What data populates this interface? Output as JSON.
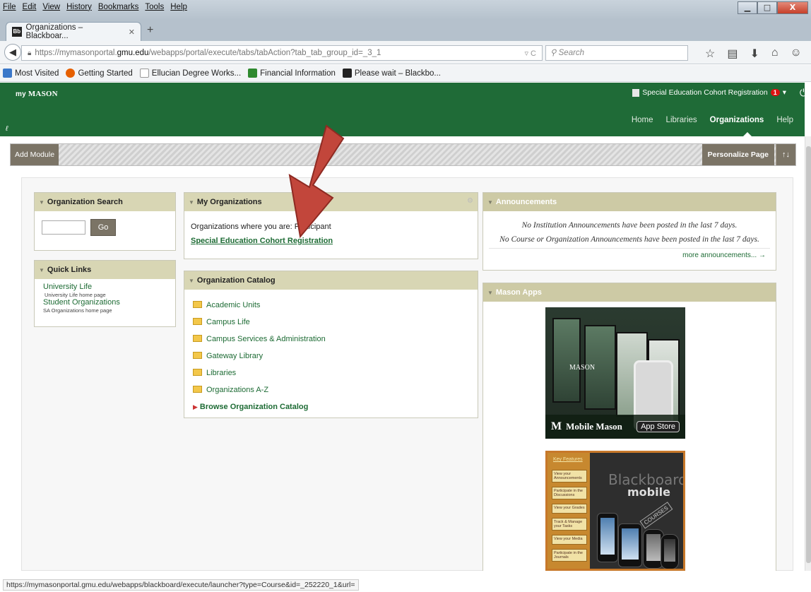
{
  "browser": {
    "menu": [
      "File",
      "Edit",
      "View",
      "History",
      "Bookmarks",
      "Tools",
      "Help"
    ],
    "tab_title": "Organizations – Blackboar...",
    "tab_favicon": "Bb",
    "url_prefix": "https://mymasonportal.",
    "url_domain": "gmu.edu",
    "url_path": "/webapps/portal/execute/tabs/tabAction?tab_tab_group_id=_3_1",
    "search_placeholder": "Search",
    "bookmarks": [
      {
        "label": "Most Visited",
        "icon": "most-visited-icon",
        "color": "#3b78c9"
      },
      {
        "label": "Getting Started",
        "icon": "firefox-icon",
        "color": "#e66000"
      },
      {
        "label": "Ellucian Degree Works...",
        "icon": "page-icon",
        "color": "#ffffff"
      },
      {
        "label": "Financial Information",
        "icon": "gmu-icon",
        "color": "#2f8a2f"
      },
      {
        "label": "Please wait – Blackbo...",
        "icon": "blackboard-icon",
        "color": "#222222"
      }
    ],
    "status_url": "https://mymasonportal.gmu.edu/webapps/blackboard/execute/launcher?type=Course&id=_252220_1&url="
  },
  "portal": {
    "logo_prefix": "my",
    "logo_main": "MASON",
    "org_registration": "Special Education Cohort Registration",
    "notification_count": "1",
    "nav": [
      "Home",
      "Libraries",
      "Organizations",
      "Help"
    ],
    "active_nav": "Organizations",
    "add_module": "Add Module",
    "personalize": "Personalize Page",
    "accent_color": "#1f6b37"
  },
  "modules": {
    "org_search": {
      "title": "Organization Search",
      "go_label": "Go"
    },
    "quick_links": {
      "title": "Quick Links",
      "items": [
        {
          "label": "University Life",
          "sub": "University Life home page"
        },
        {
          "label": "Student Organizations",
          "sub": "SA Organizations home page"
        }
      ]
    },
    "my_orgs": {
      "title": "My Organizations",
      "subtitle": "Organizations where you are: Participant",
      "link": "Special Education Cohort Registration"
    },
    "catalog": {
      "title": "Organization Catalog",
      "items": [
        "Academic Units",
        "Campus Life",
        "Campus Services & Administration",
        "Gateway Library",
        "Libraries",
        "Organizations A-Z"
      ],
      "browse": "Browse Organization Catalog"
    },
    "announcements": {
      "title": "Announcements",
      "line1": "No Institution Announcements have been posted in the last 7 days.",
      "line2": "No Course or Organization Announcements have been posted in the last 7 days.",
      "more": "more announcements..."
    },
    "mason_apps": {
      "title": "Mason Apps",
      "app1_label": "Mobile Mason",
      "app1_store": "App Store",
      "app1_logo": "MASON",
      "app2_key": "Key Features",
      "app2_items": [
        "View your Announcements",
        "Participate in the Discussions",
        "View your Grades",
        "Track & Manage your Tasks",
        "View your Media",
        "Participate in the Journals"
      ],
      "app2_title1": "Blackboard",
      "app2_title2": "mobile",
      "app2_courses": "COURSES"
    }
  }
}
